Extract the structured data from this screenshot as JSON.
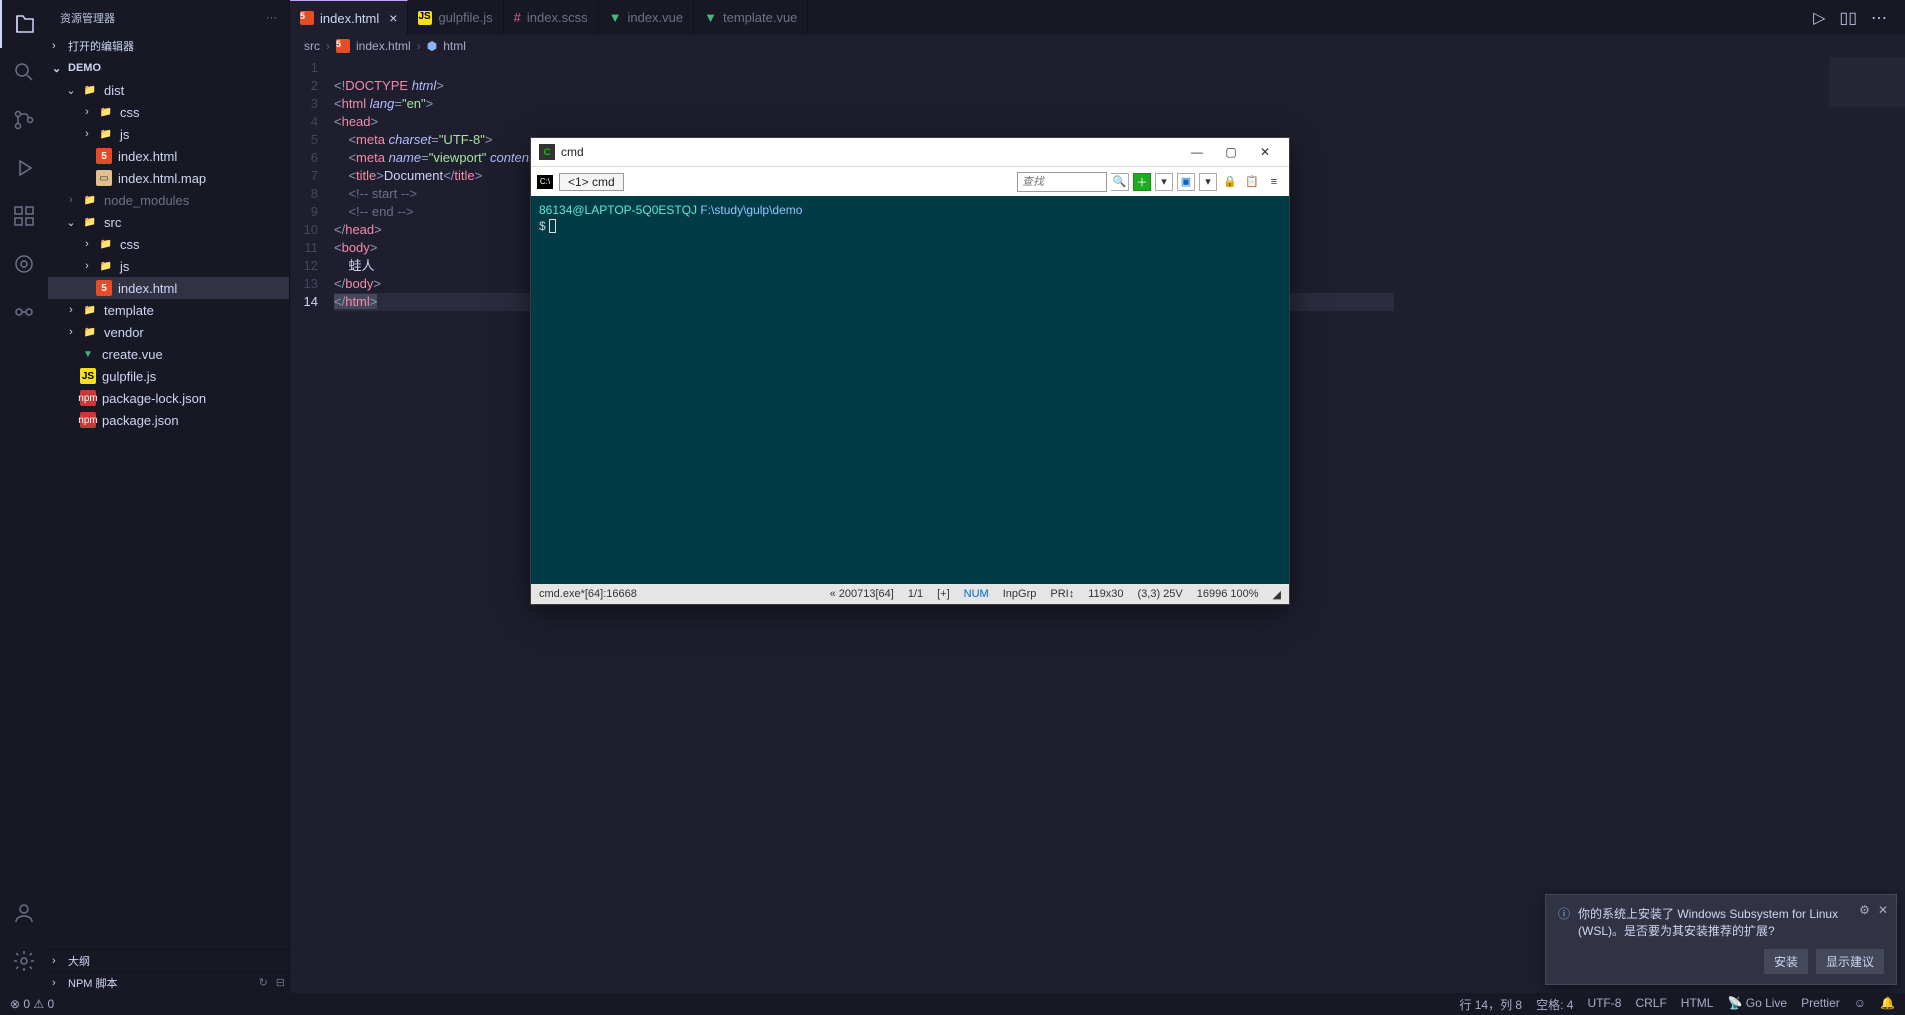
{
  "sidebar": {
    "title": "资源管理器",
    "sections": {
      "open_editors": "打开的编辑器",
      "project": "DEMO",
      "outline": "大纲",
      "npm": "NPM 脚本"
    },
    "tree": {
      "dist": "dist",
      "dist_css": "css",
      "dist_js": "js",
      "dist_index": "index.html",
      "dist_index_map": "index.html.map",
      "node_modules": "node_modules",
      "src": "src",
      "src_css": "css",
      "src_js": "js",
      "src_index": "index.html",
      "template": "template",
      "vendor": "vendor",
      "create_vue": "create.vue",
      "gulpfile": "gulpfile.js",
      "pkg_lock": "package-lock.json",
      "pkg": "package.json"
    }
  },
  "tabs": {
    "t0": "index.html",
    "t1": "gulpfile.js",
    "t2": "index.scss",
    "t3": "index.vue",
    "t4": "template.vue"
  },
  "breadcrumb": {
    "b0": "src",
    "b1": "index.html",
    "b2": "html"
  },
  "code": {
    "l1": "<!DOCTYPE html>",
    "l7_text": "Document",
    "l12_text": "蛙人"
  },
  "terminal": {
    "title": "cmd",
    "tab": "<1> cmd",
    "search_placeholder": "查找",
    "user": "86134@LAPTOP-5Q0ESTQJ",
    "path": "F:\\study\\gulp\\demo",
    "prompt": "$",
    "status_left": "cmd.exe*[64]:16668",
    "status_mem": "« 200713[64]",
    "status_pages": "1/1",
    "status_plus": "[+]",
    "status_num": "NUM",
    "status_inpgrp": "InpGrp",
    "status_pri": "PRI↕",
    "status_size": "119x30",
    "status_pos": "(3,3) 25V",
    "status_pid": "16996 100%"
  },
  "toast": {
    "message": "你的系统上安装了 Windows Subsystem for Linux (WSL)。是否要为其安装推荐的扩展?",
    "install": "安装",
    "suggest": "显示建议"
  },
  "statusbar": {
    "errors": "0",
    "warnings": "0",
    "lncol": "行 14，列 8",
    "spaces": "空格: 4",
    "encoding": "UTF-8",
    "eol": "CRLF",
    "lang": "HTML",
    "golive": "Go Live",
    "prettier": "Prettier"
  }
}
